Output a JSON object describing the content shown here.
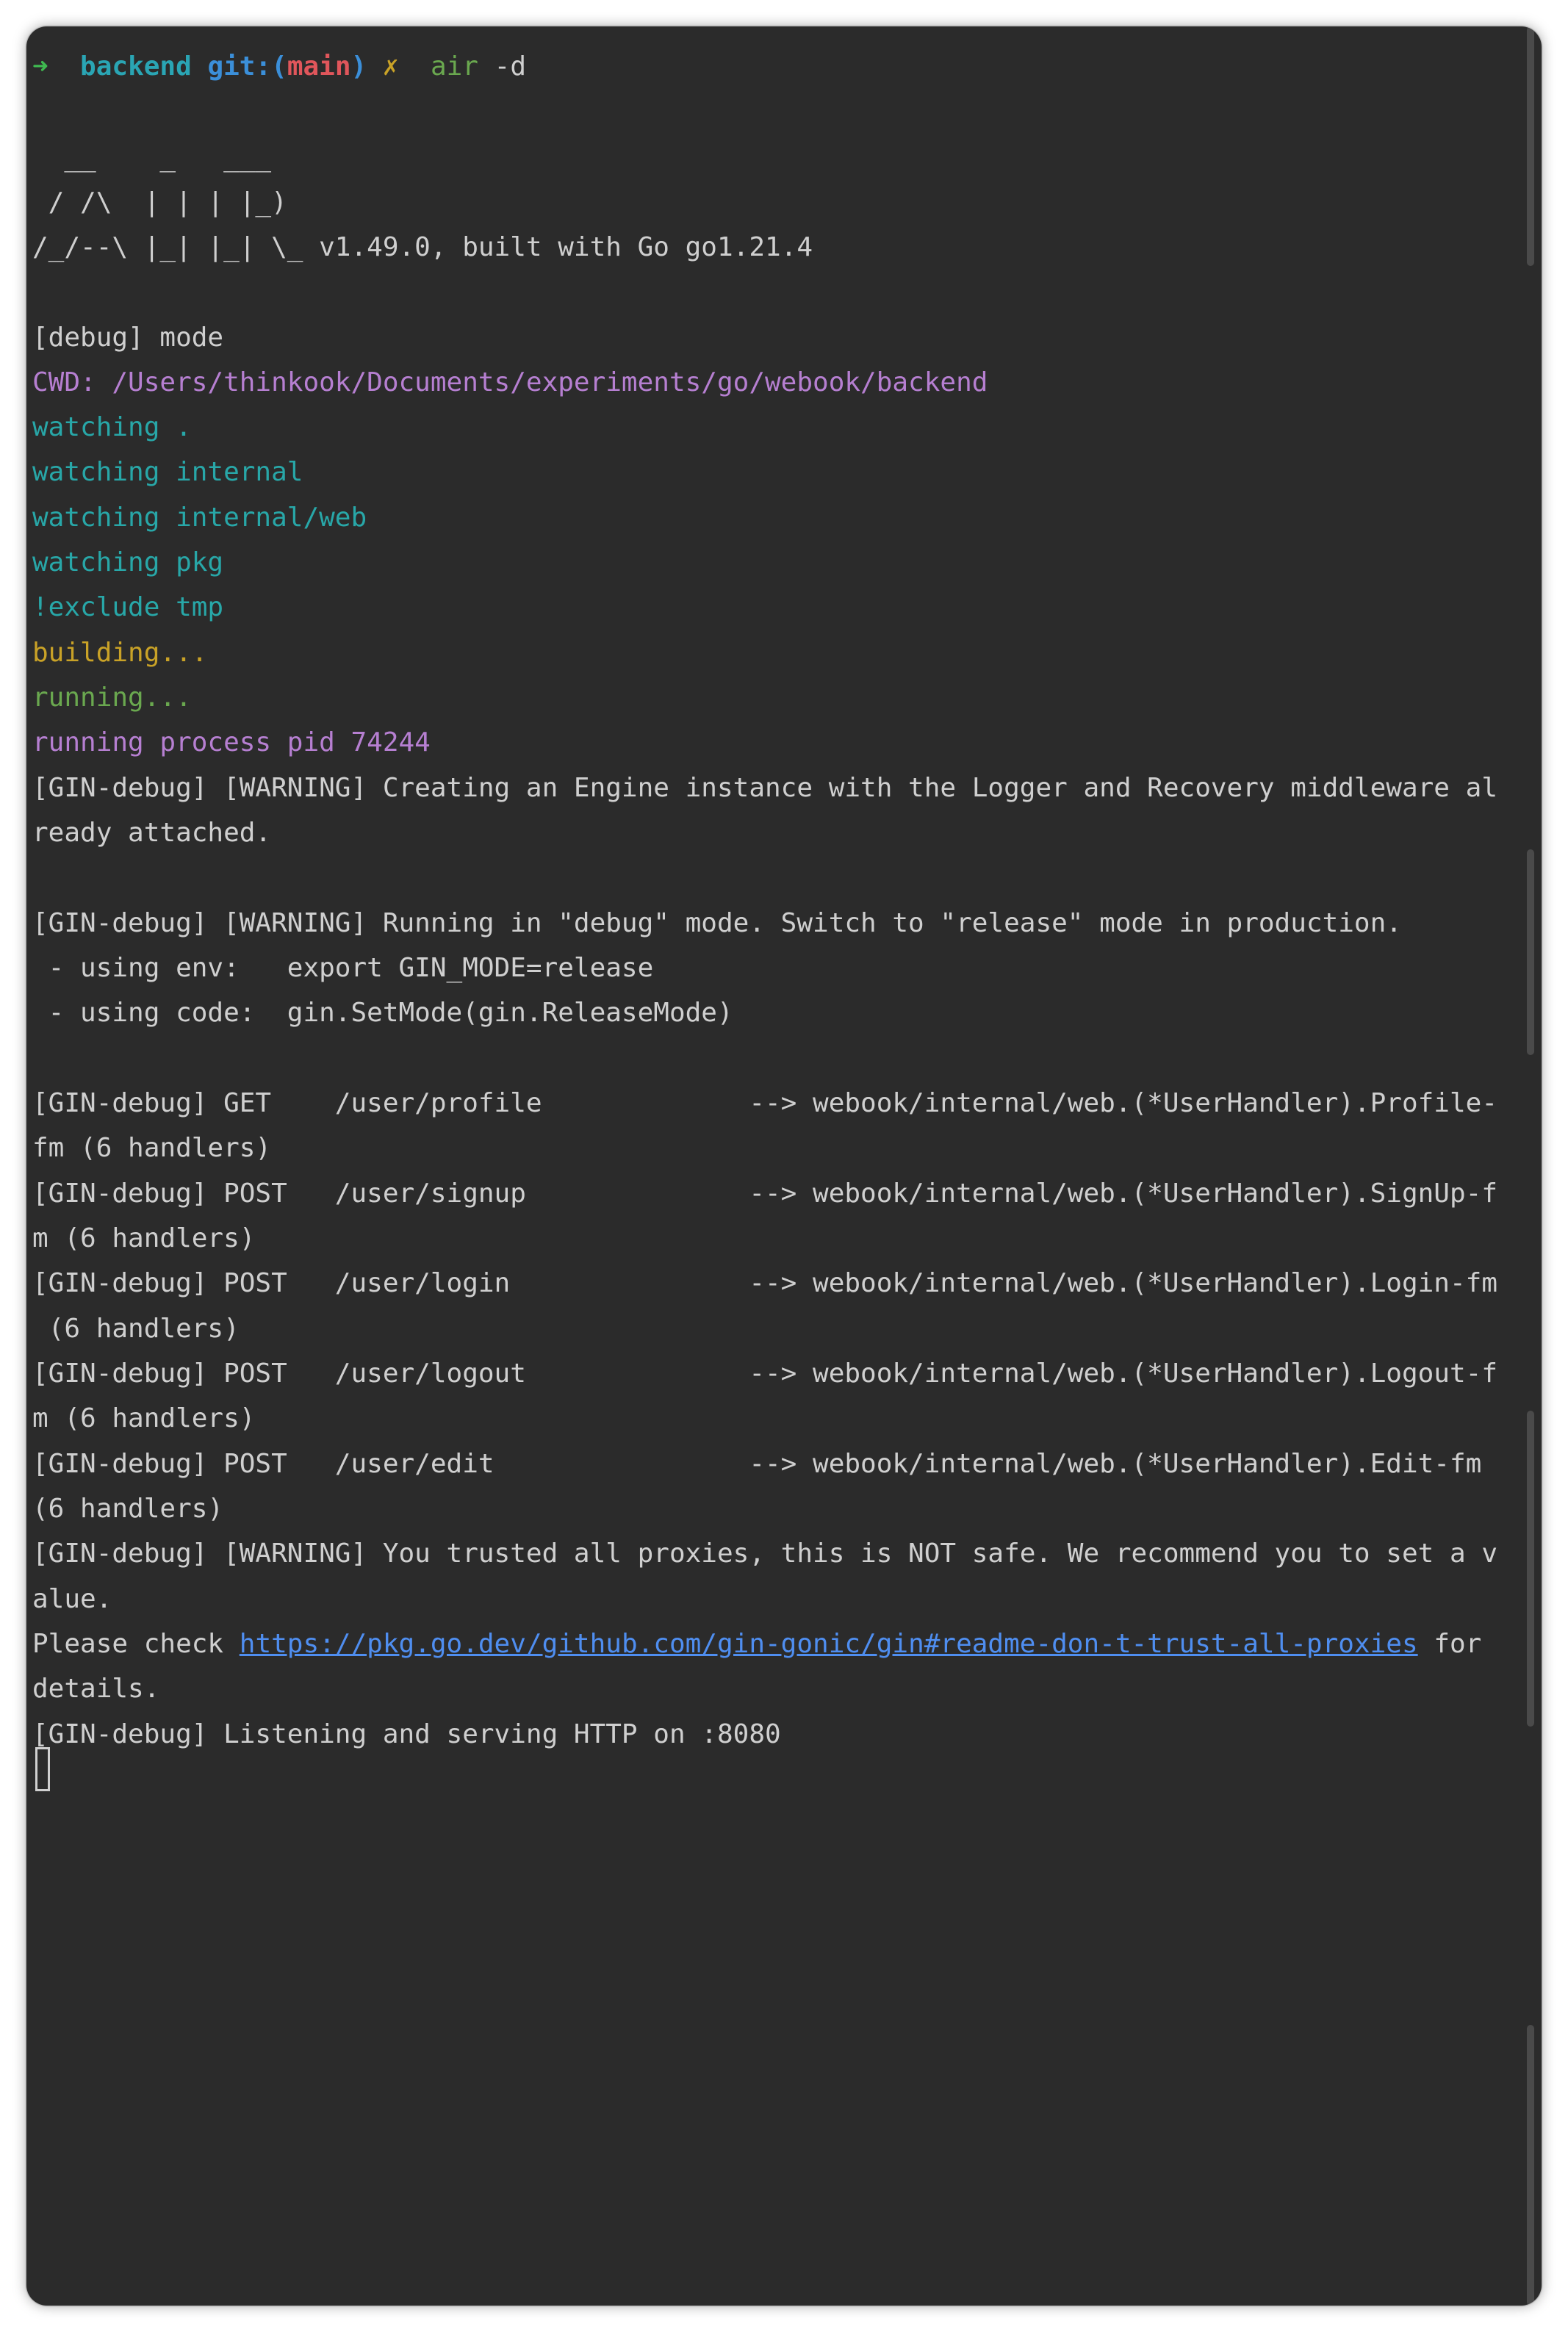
{
  "prompt": {
    "arrow": "➜",
    "dir": "backend",
    "git_prefix": "git:(",
    "branch": "main",
    "git_suffix": ")",
    "dirty_mark": "✗",
    "command": "air",
    "args": "-d"
  },
  "banner": {
    "line1": "  __    _   ___  ",
    "line2": " / /\\  | | | |_) ",
    "line3": "/_/--\\ |_| |_| \\_ v1.49.0, built with Go go1.21.4"
  },
  "air_log": {
    "debug_mode": "[debug] mode",
    "cwd": "CWD: /Users/thinkook/Documents/experiments/go/webook/backend",
    "watch_1": "watching .",
    "watch_2": "watching internal",
    "watch_3": "watching internal/web",
    "watch_4": "watching pkg",
    "exclude": "!exclude tmp",
    "building": "building...",
    "running": "running...",
    "pid": "running process pid 74244"
  },
  "gin_log": {
    "warn_engine_1": "[GIN-debug] [WARNING] Creating an Engine instance with the Logger and Recovery middleware al",
    "warn_engine_2": "ready attached.",
    "warn_mode": "[GIN-debug] [WARNING] Running in \"debug\" mode. Switch to \"release\" mode in production.",
    "env_hint": " - using env:   export GIN_MODE=release",
    "code_hint": " - using code:  gin.SetMode(gin.ReleaseMode)",
    "route_1a": "[GIN-debug] GET    /user/profile             --> webook/internal/web.(*UserHandler).Profile-",
    "route_1b": "fm (6 handlers)",
    "route_2a": "[GIN-debug] POST   /user/signup              --> webook/internal/web.(*UserHandler).SignUp-f",
    "route_2b": "m (6 handlers)",
    "route_3a": "[GIN-debug] POST   /user/login               --> webook/internal/web.(*UserHandler).Login-fm",
    "route_3b": " (6 handlers)",
    "route_4a": "[GIN-debug] POST   /user/logout              --> webook/internal/web.(*UserHandler).Logout-f",
    "route_4b": "m (6 handlers)",
    "route_5a": "[GIN-debug] POST   /user/edit                --> webook/internal/web.(*UserHandler).Edit-fm",
    "route_5b": "(6 handlers)",
    "warn_proxy_1": "[GIN-debug] [WARNING] You trusted all proxies, this is NOT safe. We recommend you to set a v",
    "warn_proxy_2": "alue.",
    "check_prefix": "Please check ",
    "check_link": "https://pkg.go.dev/github.com/gin-gonic/gin#readme-don-t-trust-all-proxies",
    "check_suffix": " for",
    "check_end": "details.",
    "listening": "[GIN-debug] Listening and serving HTTP on :8080"
  },
  "colors": {
    "background": "#2b2b2b",
    "text": "#c8c8c8",
    "purple": "#b67fd1",
    "cyan": "#28a7a8",
    "yellow": "#c9a227",
    "green": "#6aa84f",
    "link": "#4f8ef0"
  }
}
